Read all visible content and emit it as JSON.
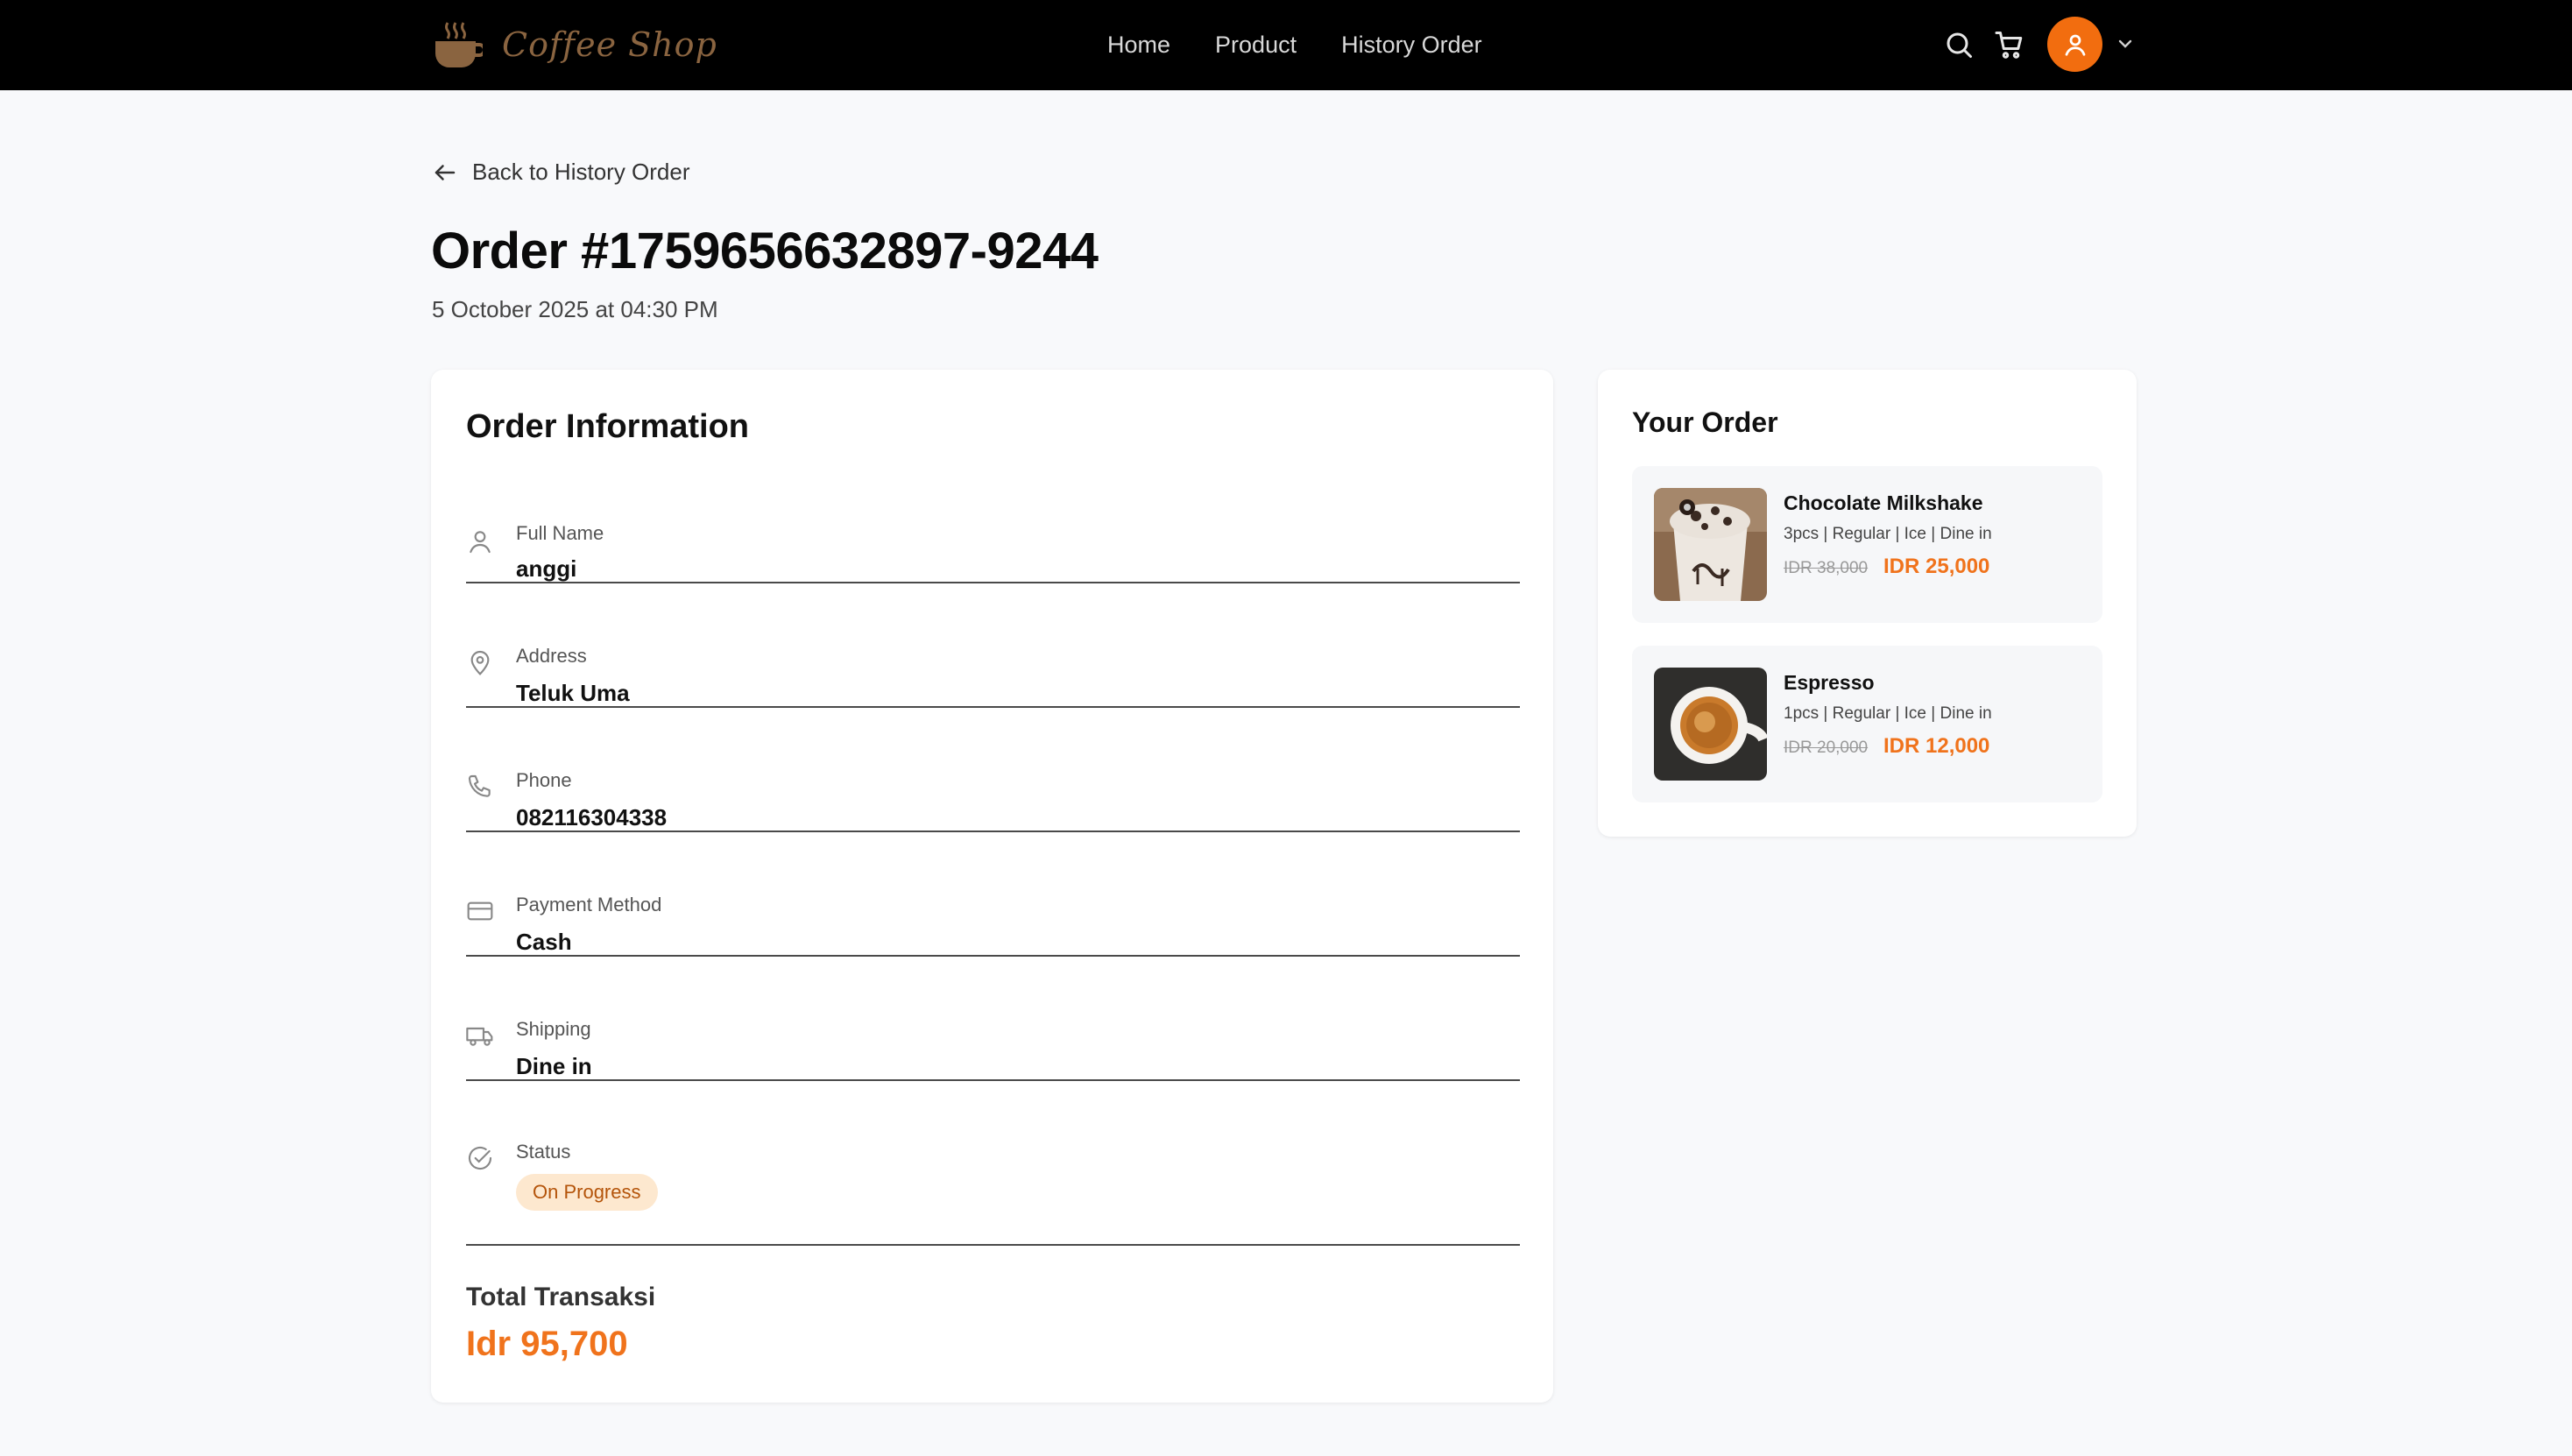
{
  "brand": {
    "name": "Coffee Shop"
  },
  "nav": {
    "links": [
      "Home",
      "Product",
      "History Order"
    ],
    "icons": [
      "search-icon",
      "cart-icon",
      "user-icon",
      "chevron-down-icon"
    ]
  },
  "back_link": {
    "label": "Back to History Order"
  },
  "order": {
    "title": "Order #1759656632897-9244",
    "date": "5 October 2025 at 04:30 PM"
  },
  "info": {
    "title": "Order Information",
    "fields": [
      {
        "label": "Full Name",
        "value": "anggi",
        "icon": "user-icon"
      },
      {
        "label": "Address",
        "value": "Teluk Uma",
        "icon": "map-pin-icon"
      },
      {
        "label": "Phone",
        "value": "082116304338",
        "icon": "phone-icon"
      },
      {
        "label": "Payment Method",
        "value": "Cash",
        "icon": "credit-card-icon"
      },
      {
        "label": "Shipping",
        "value": "Dine in",
        "icon": "truck-icon"
      },
      {
        "label": "Status",
        "value": "On Progress",
        "icon": "check-circle-icon"
      }
    ],
    "total_label": "Total Transaksi",
    "total_value": "Idr 95,700"
  },
  "your_order": {
    "title": "Your Order",
    "items": [
      {
        "name": "Chocolate Milkshake",
        "meta": "3pcs | Regular | Ice | Dine in",
        "old_price": "IDR 38,000",
        "price": "IDR 25,000"
      },
      {
        "name": "Espresso",
        "meta": "1pcs | Regular | Ice | Dine in",
        "old_price": "IDR 20,000",
        "price": "IDR 12,000"
      }
    ]
  },
  "colors": {
    "accent": "#f0731c",
    "avatar": "#f26d0f",
    "navbar": "#000000",
    "badge_bg": "#fde8cf",
    "badge_text": "#b4540a"
  }
}
